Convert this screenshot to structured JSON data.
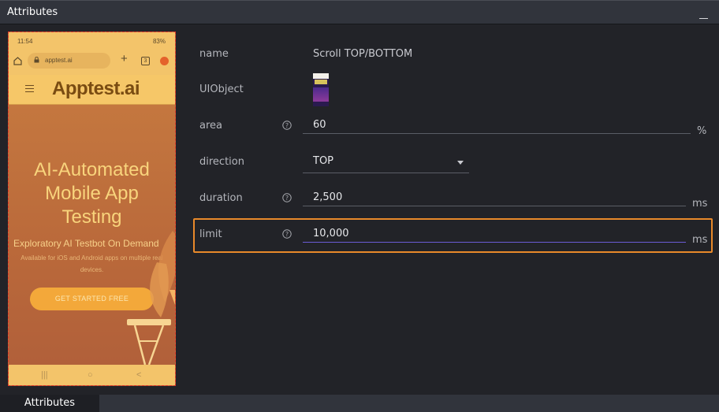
{
  "window": {
    "title": "Attributes"
  },
  "phone": {
    "status_time": "11:54",
    "status_battery": "83%",
    "url": "apptest.ai",
    "tab_count": "3",
    "logo": "Apptest.ai",
    "hero_title_1": "AI-Automated",
    "hero_title_2": "Mobile App",
    "hero_title_3": "Testing",
    "hero_subtitle": "Exploratory AI Testbot On Demand",
    "hero_desc_1": "Available for iOS and Android apps on multiple real",
    "hero_desc_2": "devices.",
    "cta": "GET STARTED FREE",
    "nav_recent": "|||",
    "nav_home": "○",
    "nav_back": "<"
  },
  "attributes": {
    "name": {
      "label": "name",
      "value": "Scroll TOP/BOTTOM"
    },
    "uiobject": {
      "label": "UIObject"
    },
    "area": {
      "label": "area",
      "value": "60",
      "unit": "%"
    },
    "direction": {
      "label": "direction",
      "value": "TOP"
    },
    "duration": {
      "label": "duration",
      "value": "2,500",
      "unit": "ms"
    },
    "limit": {
      "label": "limit",
      "value": "10,000",
      "unit": "ms"
    }
  },
  "bottom_tab": {
    "label": "Attributes"
  },
  "colors": {
    "highlight": "#e8892a",
    "background": "#222328",
    "selection_border": "#e23a2a"
  },
  "icons": [
    "minimize-icon",
    "help-icon",
    "chevron-down-icon",
    "home-icon",
    "lock-icon",
    "menu-icon"
  ]
}
